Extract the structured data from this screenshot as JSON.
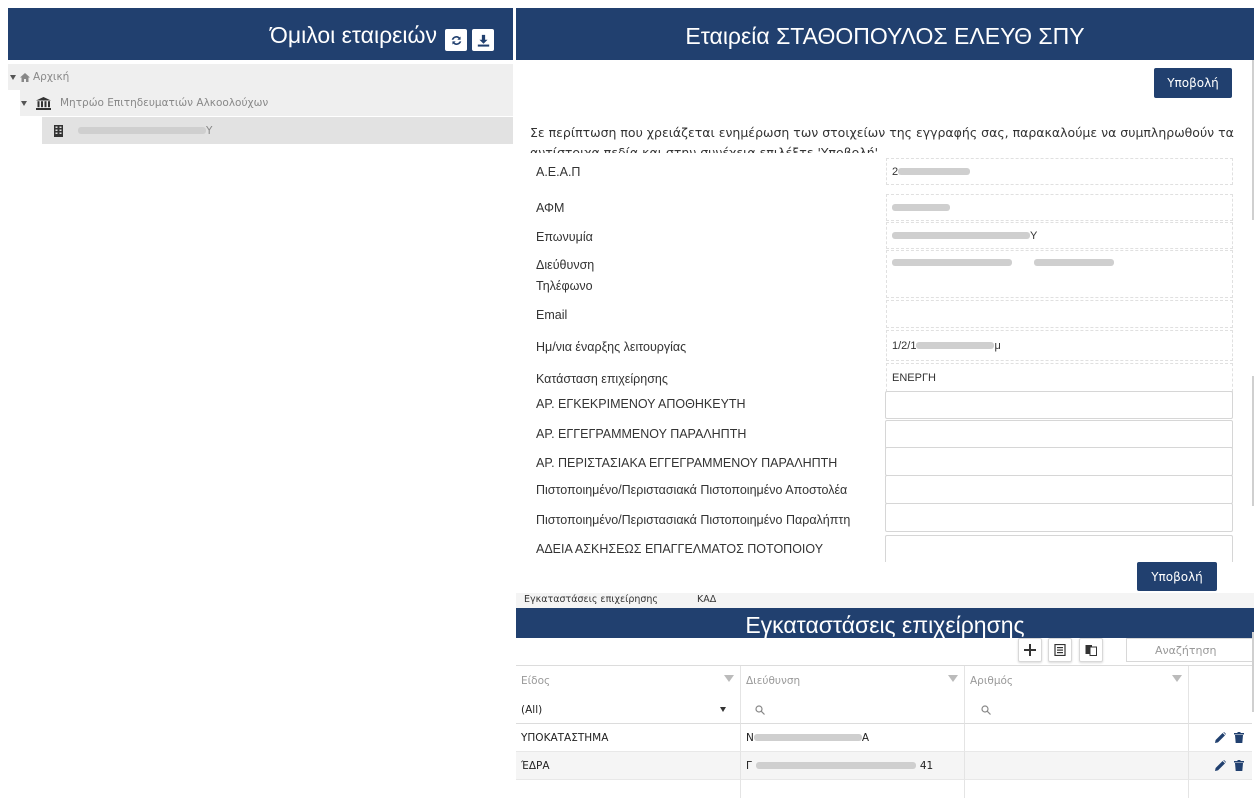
{
  "left_panel": {
    "title": "Όμιλοι εταιρειών",
    "refresh_icon": "refresh-icon",
    "download_icon": "download-icon",
    "tree": {
      "home": {
        "label": "Αρχική",
        "icon": "home-icon"
      },
      "registry": {
        "label": "Μητρώο Επιτηδευματιών Αλκοολούχων",
        "icon": "building-columns-icon"
      },
      "company": {
        "label_suffix": "Υ",
        "icon": "office-building-icon"
      }
    }
  },
  "right_panel": {
    "title": "Εταιρεία ΣΤΑΘΟΠΟΥΛΟΣ ΕΛΕΥΘ ΣΠΥ",
    "submit_label": "Υποβολή",
    "info_text": "Σε περίπτωση που χρειάζεται ενημέρωση των στοιχείων της εγγραφής σας, παρακαλούμε να συμπληρωθούν τα αντίστοιχα πεδία και στην συνέχεια επιλέξτε 'Υποβολή'",
    "fields": [
      {
        "label": "Α.Ε.Α.Π",
        "value": "2"
      },
      {
        "label": "ΑΦΜ",
        "value": ""
      },
      {
        "label": "Επωνυμία",
        "value": "Υ"
      },
      {
        "label": "Διεύθυνση",
        "value": ""
      },
      {
        "label": "Τηλέφωνο",
        "value": ""
      },
      {
        "label": "Email",
        "value": ""
      },
      {
        "label": "Ημ/νια έναρξης λειτουργίας",
        "value": "1/2/1",
        "value_suffix": "μ"
      },
      {
        "label": "Κατάσταση επιχείρησης",
        "value": "ΕΝΕΡΓΗ"
      }
    ],
    "input_fields": [
      {
        "label": "ΑΡ. ΕΓΚΕΚΡΙΜΕΝΟΥ ΑΠΟΘΗΚΕΥΤΗ",
        "value": ""
      },
      {
        "label": "ΑΡ. ΕΓΓΕΓΡΑΜΜΕΝΟΥ ΠΑΡΑΛΗΠΤΗ",
        "value": ""
      },
      {
        "label": "ΑΡ. ΠΕΡΙΣΤΑΣΙΑΚΑ ΕΓΓΕΓΡΑΜΜΕΝΟΥ ΠΑΡΑΛΗΠΤΗ",
        "value": ""
      },
      {
        "label": "Πιστοποιημένο/Περιστασιακά Πιστοποιημένο Αποστολέα",
        "value": ""
      },
      {
        "label": "Πιστοποιημένο/Περιστασιακά Πιστοποιημένο Παραλήπτη",
        "value": ""
      },
      {
        "label": "ΑΔΕΙΑ ΑΣΚΗΣΕΩΣ ΕΠΑΓΓΕΛΜΑΤΟΣ ΠΟΤΟΠΟΙΟΥ",
        "value": ""
      }
    ]
  },
  "facilities": {
    "tabs": [
      "Εγκαταστάσεις επιχείρησης",
      "ΚΑΔ"
    ],
    "title": "Εγκαταστάσεις επιχείρησης",
    "toolbar": {
      "add_icon": "plus-icon",
      "export_icon_1": "export-excel-icon",
      "export_icon_2": "export-pdf-icon"
    },
    "search_placeholder": "Αναζήτηση",
    "columns": [
      "Είδος",
      "Διεύθυνση",
      "Αριθμός"
    ],
    "filter": {
      "type_value": "(All)"
    },
    "rows": [
      {
        "type": "ΥΠΟΚΑΤΑΣΤΗΜΑ",
        "address_prefix": "Ν",
        "address_suffix": "Α",
        "number": ""
      },
      {
        "type": "ΈΔΡΑ",
        "address_prefix": "Γ",
        "address_suffix": "41",
        "number": ""
      }
    ],
    "row_actions": [
      "edit-icon",
      "delete-icon"
    ]
  },
  "colors": {
    "header_bg": "#21406f",
    "accent": "#21406f"
  }
}
